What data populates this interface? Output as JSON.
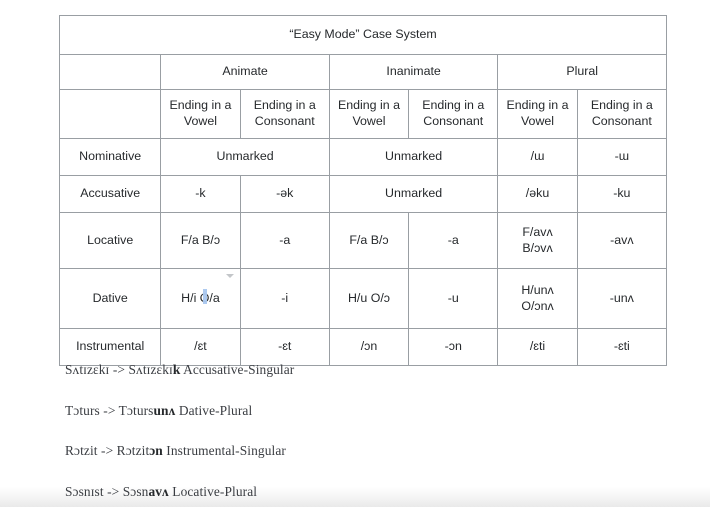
{
  "table": {
    "title": "“Easy Mode” Case System",
    "groups": [
      "Animate",
      "Inanimate",
      "Plural"
    ],
    "sub_headers": [
      "Ending in a Vowel",
      "Ending in a Consonant",
      "Ending in a Vowel",
      "Ending in a Consonant",
      "Ending in a Vowel",
      "Ending in a Consonant"
    ],
    "rows": [
      {
        "case": "Nominative",
        "animate_merged": "Unmarked",
        "inanimate_merged": "Unmarked",
        "plural_vowel": "/ɯ",
        "plural_consonant": "-ɯ"
      },
      {
        "case": "Accusative",
        "animate_vowel": "-k",
        "animate_consonant": "-ək",
        "inanimate_merged": "Unmarked",
        "plural_vowel": "/əku",
        "plural_consonant": "-ku"
      },
      {
        "case": "Locative",
        "animate_vowel": "F/a B/ɔ",
        "animate_consonant": "-a",
        "inanimate_vowel": "F/a B/ɔ",
        "inanimate_consonant": "-a",
        "plural_vowel_line1": "F/avʌ",
        "plural_vowel_line2": "B/ɔvʌ",
        "plural_consonant": "-avʌ"
      },
      {
        "case": "Dative",
        "animate_vowel": "H/i O/a",
        "animate_consonant": "-i",
        "inanimate_vowel": "H/u O/ɔ",
        "inanimate_consonant": "-u",
        "plural_vowel_line1": "H/unʌ",
        "plural_vowel_line2": "O/ɔnʌ",
        "plural_consonant": "-unʌ"
      },
      {
        "case": "Instrumental",
        "animate_vowel": "/ɛt",
        "animate_consonant": "-ɛt",
        "inanimate_vowel": "/ɔn",
        "inanimate_consonant": "-ɔn",
        "plural_vowel": "/ɛti",
        "plural_consonant": "-ɛti"
      }
    ]
  },
  "examples": [
    {
      "base": "Sʌtɪzɛkɪ -> Sʌtɪzɛkɪ",
      "affix": "k",
      "gloss": " Accusative-Singular"
    },
    {
      "base": "Tɔturs -> Tɔturs",
      "affix": "unʌ",
      "gloss": " Dative-Plural"
    },
    {
      "base": "Rɔtzit -> Rɔtzit",
      "affix": "ɔn",
      "gloss": " Instrumental-Singular"
    },
    {
      "base": "Sɔsnɪst -> Sɔsn",
      "affix": "avʌ",
      "gloss": " Locative-Plural"
    }
  ],
  "colors": {
    "border": "#999ea3",
    "text": "#26292c",
    "caret_highlight": "#a9c7ef"
  }
}
